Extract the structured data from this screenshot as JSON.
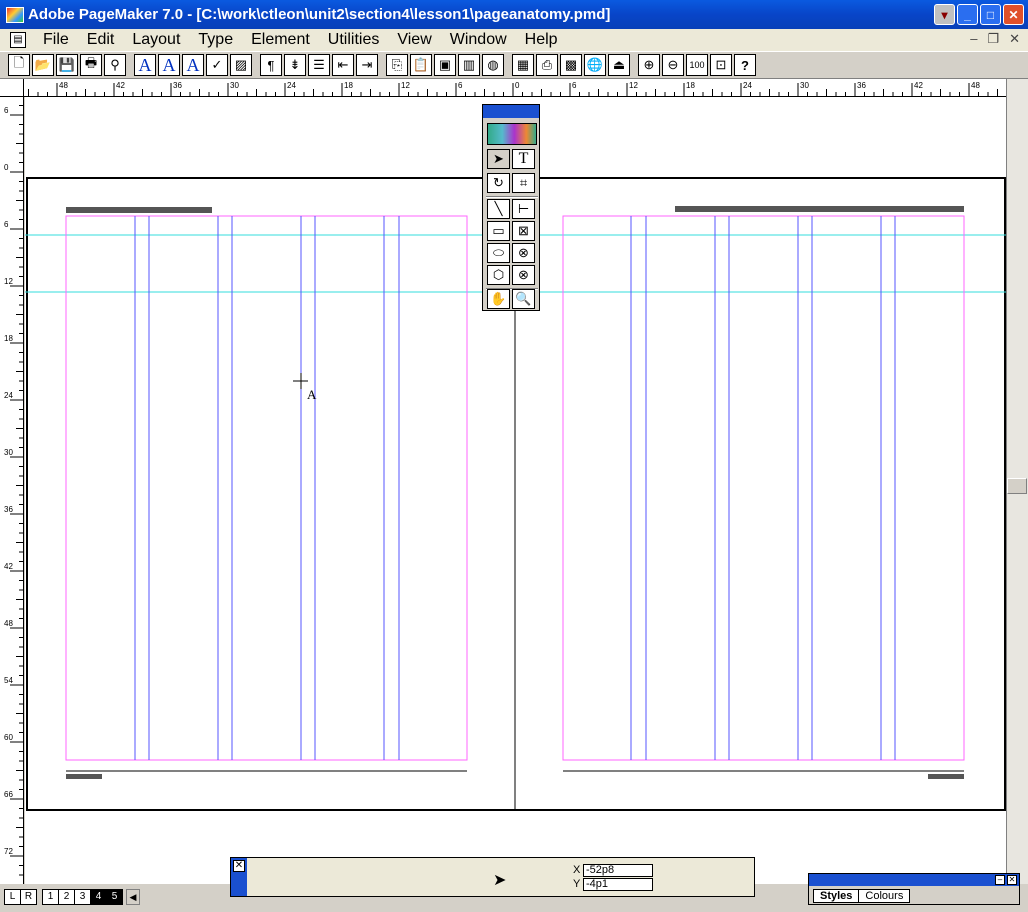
{
  "window": {
    "title": "Adobe PageMaker 7.0 - [C:\\work\\ctleon\\unit2\\section4\\lesson1\\pageanatomy.pmd]"
  },
  "menu": [
    "File",
    "Edit",
    "Layout",
    "Type",
    "Element",
    "Utilities",
    "View",
    "Window",
    "Help"
  ],
  "toolbar_glyphs": {
    "type_a": "A",
    "type_a_up": "A",
    "type_a_down": "A",
    "pilcrow": "¶",
    "help": "?",
    "zoom100": "100"
  },
  "rulers": {
    "top_labels": [
      "48",
      "42",
      "36",
      "30",
      "24",
      "18",
      "12",
      "6",
      "0",
      "6",
      "12",
      "18",
      "24",
      "30",
      "36",
      "42",
      "48"
    ],
    "left_labels": [
      "6",
      "0",
      "6",
      "12",
      "18",
      "24",
      "30",
      "36",
      "42",
      "48",
      "54",
      "60",
      "66",
      "72"
    ]
  },
  "cursor_label": "A",
  "page_tabs": [
    "L",
    "R",
    "1",
    "2",
    "3",
    "4",
    "5"
  ],
  "active_pages": [
    "4",
    "5"
  ],
  "control_palette": {
    "x_label": "X",
    "x_value": "-52p8",
    "y_label": "Y",
    "y_value": "-4p1"
  },
  "styles_palette": {
    "tabs": [
      "Styles",
      "Colours"
    ]
  },
  "toolbox": {
    "text_tool": "T"
  },
  "colors": {
    "margin_guide": "#ff66ff",
    "column_guide": "#5555ff",
    "ruler_guide": "#33dddd",
    "title_bar": "#0a5ae0"
  }
}
